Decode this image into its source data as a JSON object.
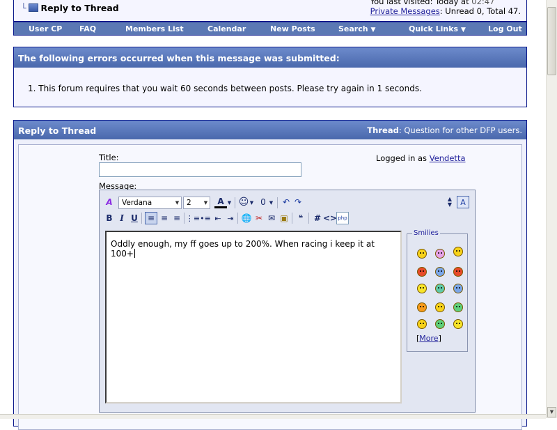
{
  "header": {
    "page_title": "Reply to Thread",
    "last_visited_prefix": "You last visited:",
    "last_visited_value": "Today at",
    "last_visited_time": "02:47",
    "pm_link": "Private Messages",
    "pm_status": ": Unread 0, Total 47."
  },
  "navbar": {
    "items": [
      "User CP",
      "FAQ",
      "Members List",
      "Calendar",
      "New Posts",
      "Search",
      "Quick Links",
      "Log Out"
    ]
  },
  "error": {
    "heading": "The following errors occurred when this message was submitted:",
    "message": "1.  This forum requires that you wait 60 seconds between posts. Please try again in 1 seconds."
  },
  "reply": {
    "heading": "Reply to Thread",
    "thread_label": "Thread",
    "thread_name": ": Question for other DFP users.",
    "title_label": "Title:",
    "title_value": "",
    "logged_in_prefix": "Logged in as",
    "username": "Vendetta",
    "message_label": "Message:"
  },
  "editor": {
    "font_select": "Verdana",
    "size_select": "2",
    "toolbar_row2": {
      "bold": "B",
      "italic": "I",
      "underline": "U",
      "hash": "#",
      "code": "<>"
    },
    "message_text": "Oddly enough, my ff goes up to 200%. When racing i keep it at 100+",
    "smilies_legend": "Smilies",
    "more_link": "More",
    "more_bracket_open": "[",
    "more_bracket_close": "]"
  },
  "colors": {
    "header_gradient_top": "#6d8bcc",
    "header_gradient_bottom": "#4a68ac",
    "nav_bg": "#5b78b4",
    "link": "#22229c",
    "panel_bg": "#f5f5ff"
  }
}
